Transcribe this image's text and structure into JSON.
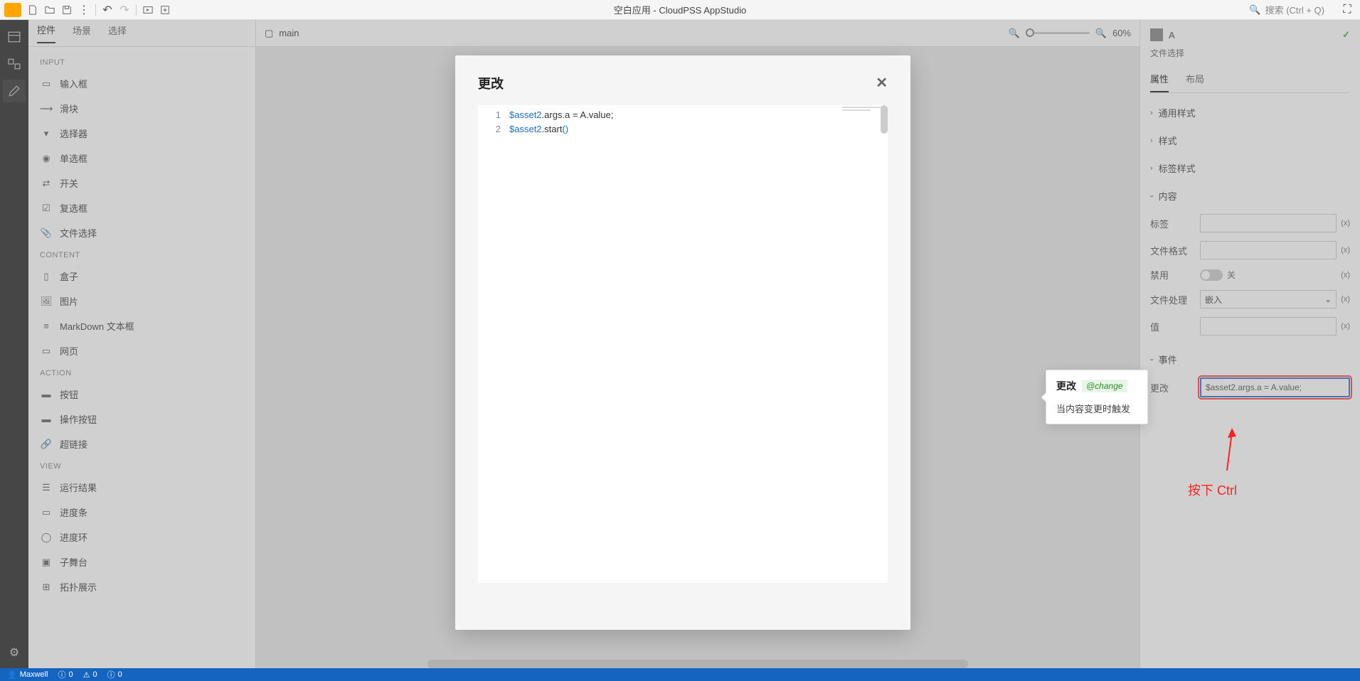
{
  "app_title": "空白应用 - CloudPSS AppStudio",
  "search_placeholder": "搜索 (Ctrl + Q)",
  "left_tabs": [
    "控件",
    "场景",
    "选择"
  ],
  "sections": {
    "input": {
      "head": "INPUT",
      "items": [
        "输入框",
        "滑块",
        "选择器",
        "单选框",
        "开关",
        "复选框",
        "文件选择"
      ]
    },
    "content": {
      "head": "CONTENT",
      "items": [
        "盒子",
        "图片",
        "MarkDown 文本框",
        "网页"
      ]
    },
    "action": {
      "head": "ACTION",
      "items": [
        "按钮",
        "操作按钮",
        "超链接"
      ]
    },
    "view": {
      "head": "VIEW",
      "items": [
        "运行结果",
        "进度条",
        "进度环",
        "子舞台",
        "拓扑展示"
      ]
    }
  },
  "center_tab": "main",
  "zoom": "60%",
  "right": {
    "name": "A",
    "subtitle": "文件选择",
    "tabs": [
      "属性",
      "布局"
    ],
    "sections": {
      "general_style": "通用样式",
      "style": "样式",
      "label_style": "标签样式",
      "content": "内容",
      "events": "事件"
    },
    "content_fields": {
      "label": "标签",
      "file_format": "文件格式",
      "disabled": "禁用",
      "disabled_off": "关",
      "file_handle": "文件处理",
      "file_handle_val": "嵌入",
      "value": "值"
    },
    "event_label": "更改",
    "event_value": "$asset2.args.a = A.value;",
    "fx": "(x)"
  },
  "tooltip": {
    "title": "更改",
    "badge": "@change",
    "desc": "当内容变更时触发"
  },
  "modal": {
    "title": "更改",
    "code": {
      "l1_a": "$asset2",
      "l1_b": ".args.a",
      "l1_c": " = ",
      "l1_d": "A.value",
      "l1_e": ";",
      "l2_a": "$asset2",
      "l2_b": ".start",
      "l2_p1": "(",
      "l2_p2": ")"
    }
  },
  "annotation": "按下 Ctrl",
  "status": {
    "user": "Maxwell",
    "err": "0",
    "warn": "0",
    "info": "0"
  }
}
